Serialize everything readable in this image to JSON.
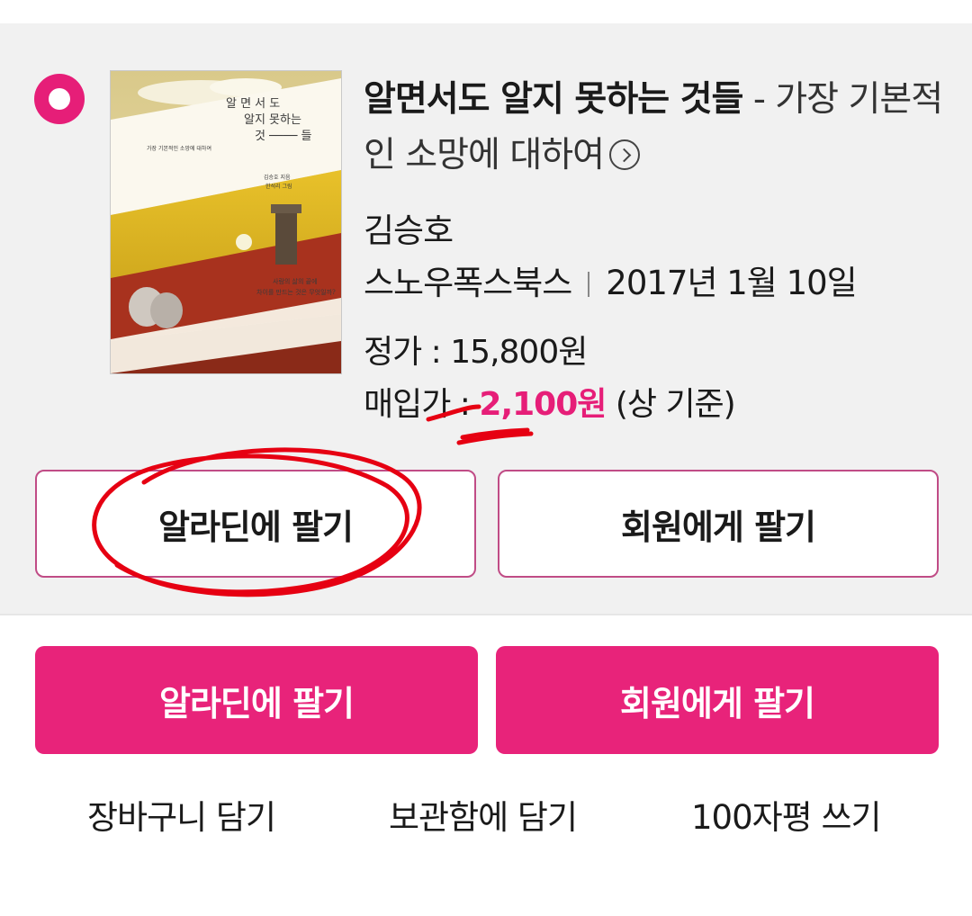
{
  "book": {
    "title_main": "알면서도 알지 못하는 것들",
    "title_sub": " - 가장 기본적인 소망에 대하여",
    "author": "김승호",
    "publisher": "스노우폭스북스",
    "date": "2017년 1월 10일",
    "list_price_label": "정가 : ",
    "list_price": "15,800원",
    "buy_price_label": "매입가 : ",
    "buy_price": "2,100원",
    "buy_price_note": " (상 기준)"
  },
  "cover": {
    "title_line1": "알 면 서 도",
    "title_line2": "알지 못하는",
    "title_line3": "것 ──── 들",
    "subtitle": "가장 기본적인 소망에 대하여",
    "byline1": "김승호 지음",
    "byline2": "한석리 그림",
    "tagline1": "사람의 삶의 끝에",
    "tagline2": "차이를 만드는 것은 무엇일까?"
  },
  "actions": {
    "sell_aladin_outline": "알라딘에 팔기",
    "sell_member_outline": "회원에게 팔기",
    "sell_aladin_solid": "알라딘에 팔기",
    "sell_member_solid": "회원에게 팔기"
  },
  "links": {
    "cart": "장바구니 담기",
    "storage": "보관함에 담기",
    "review": "100자평 쓰기"
  },
  "colors": {
    "accent": "#e61e78",
    "card_bg": "#f1f1f1",
    "annotation_red": "#e60012"
  },
  "icons": {
    "radio": "radio-selected-icon",
    "detail": "chevron-right-circle-icon"
  }
}
